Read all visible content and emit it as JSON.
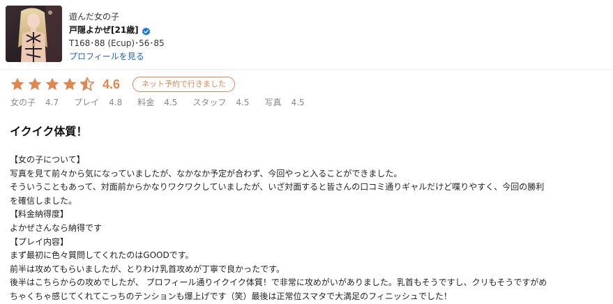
{
  "profile": {
    "shop_name": "遊んだ女の子",
    "girl_name": "戸隠よかぜ[21歳]",
    "verified_icon": "verified-check-icon",
    "spec": "T168･88 (Ecup)･56･85",
    "profile_link": "プロフィールを見る"
  },
  "rating": {
    "stars": 4.5,
    "score": "4.6",
    "badge": "ネット予約で行きました",
    "accent_color": "#e0874f",
    "sub_ratings": [
      {
        "label": "女の子",
        "value": "4.7"
      },
      {
        "label": "プレイ",
        "value": "4.8"
      },
      {
        "label": "料金",
        "value": "4.5"
      },
      {
        "label": "スタッフ",
        "value": "4.5"
      },
      {
        "label": "写真",
        "value": "4.5"
      }
    ]
  },
  "review": {
    "title": "イクイク体質！",
    "lines": [
      "【女の子について】",
      "写真を見て前々から気になっていましたが、なかなか予定が合わず、今回やっと入ることができました。",
      "そういうこともあって、対面前からかなりワクワクしていましたが、いざ対面すると皆さんの口コミ通りギャルだけど喋りやすく、今回の勝利",
      "を確信しました。",
      "【料金納得度】",
      "よかぜさんなら納得です",
      "【プレイ内容】",
      "まず最初に色々質問してくれたのはGOODです。",
      "前半は攻めてもらいましたが、とりわけ乳首攻めが丁寧で良かったです。",
      "後半はこちらからの攻めでしたが、 プロフィール通りイクイク体質！で非常に攻めがいがありました。乳首もそうですし、クリもそうですがめ",
      "ちゃくちゃ感じてくれてこっちのテンションも爆上げです（笑）最後は正常位スマタで大満足のフィニッシュでした！"
    ]
  }
}
